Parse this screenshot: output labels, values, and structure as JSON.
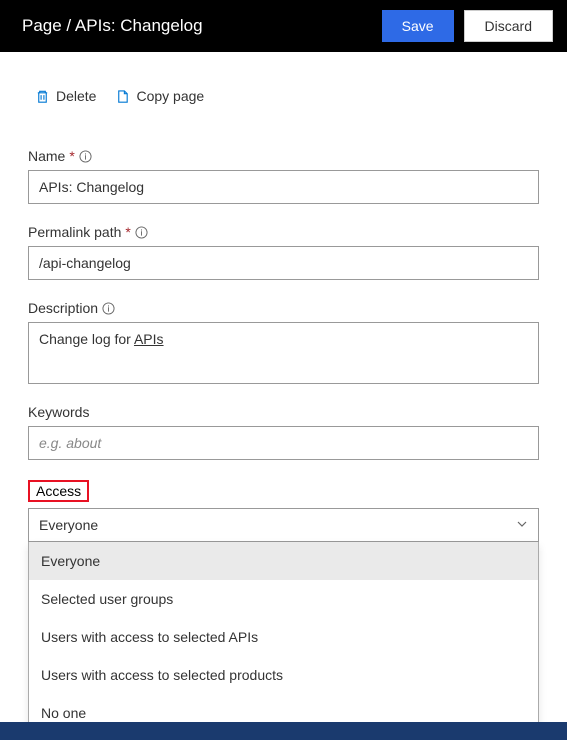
{
  "header": {
    "title": "Page / APIs: Changelog",
    "save_label": "Save",
    "discard_label": "Discard"
  },
  "actions": {
    "delete_label": "Delete",
    "copy_label": "Copy page"
  },
  "fields": {
    "name": {
      "label": "Name",
      "value": "APIs: Changelog"
    },
    "permalink": {
      "label": "Permalink path",
      "value": "/api-changelog"
    },
    "description": {
      "label": "Description",
      "value_prefix": "Change log for ",
      "value_underlined": "APIs"
    },
    "keywords": {
      "label": "Keywords",
      "placeholder": "e.g. about"
    },
    "access": {
      "label": "Access",
      "selected": "Everyone",
      "options": [
        "Everyone",
        "Selected user groups",
        "Users with access to selected APIs",
        "Users with access to selected products",
        "No one"
      ]
    }
  }
}
